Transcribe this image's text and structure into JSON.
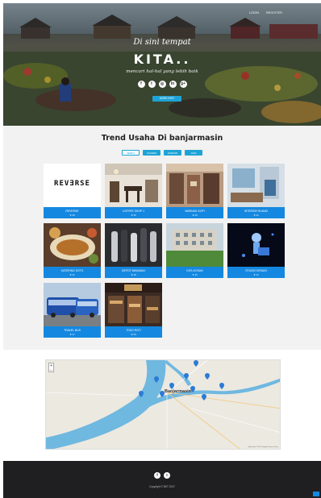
{
  "nav": {
    "items": [
      "LOGIN",
      "REGISTER"
    ]
  },
  "hero": {
    "tagline": "Di sini tempat",
    "title": "KITA..",
    "subtitle": "mencari hal-hal yang lebih baik",
    "social_icons": [
      "facebook-icon",
      "twitter-icon",
      "instagram-icon",
      "linkedin-icon",
      "google-plus-icon"
    ],
    "social_glyphs": [
      "f",
      "t",
      "◎",
      "in",
      "g+"
    ],
    "cta_label": "MORE INFO"
  },
  "trend": {
    "title": "Trend Usaha Di banjarmasin",
    "filters": [
      {
        "label": "SEMUA",
        "active": true
      },
      {
        "label": "KULINER",
        "active": false
      },
      {
        "label": "FASHION",
        "active": false
      },
      {
        "label": "JASA",
        "active": false
      }
    ],
    "items": [
      {
        "name": "REVERSE",
        "count": "★ 48",
        "kind": "reverse"
      },
      {
        "name": "COFFEE SHOP 1",
        "count": "★ 36",
        "kind": "cafe"
      },
      {
        "name": "WARUNG KOPI",
        "count": "★ 29",
        "kind": "shop"
      },
      {
        "name": "INTERIOR RUANG",
        "count": "★ 22",
        "kind": "interior"
      },
      {
        "name": "KATERING SOTO",
        "count": "★ 41",
        "kind": "food"
      },
      {
        "name": "DEPOT MINUMAN",
        "count": "★ 18",
        "kind": "bottles"
      },
      {
        "name": "KOS-KOSAN",
        "count": "★ 15",
        "kind": "building"
      },
      {
        "name": "STUDIO DESAIN",
        "count": "★ 12",
        "kind": "digital"
      },
      {
        "name": "TRAVEL BUS",
        "count": "★ 27",
        "kind": "bus"
      },
      {
        "name": "TOKO ROTI",
        "count": "★ 33",
        "kind": "bakery"
      }
    ],
    "reverse_logo": "REV∃RSE"
  },
  "map": {
    "city_label": "Banjarmasin",
    "zoom_in": "+",
    "zoom_out": "−",
    "attribution": "Map data ©2017 Google  Terms of Use"
  },
  "footer": {
    "social_icons": [
      "facebook-icon",
      "twitter-icon"
    ],
    "social_glyphs": [
      "f",
      "t"
    ],
    "copyright": "Copyright © BKT 2017"
  },
  "colors": {
    "accent": "#1488e0",
    "accent_light": "#1ea3d6",
    "footer": "#1f1f22",
    "river": "#6fb8e0"
  }
}
